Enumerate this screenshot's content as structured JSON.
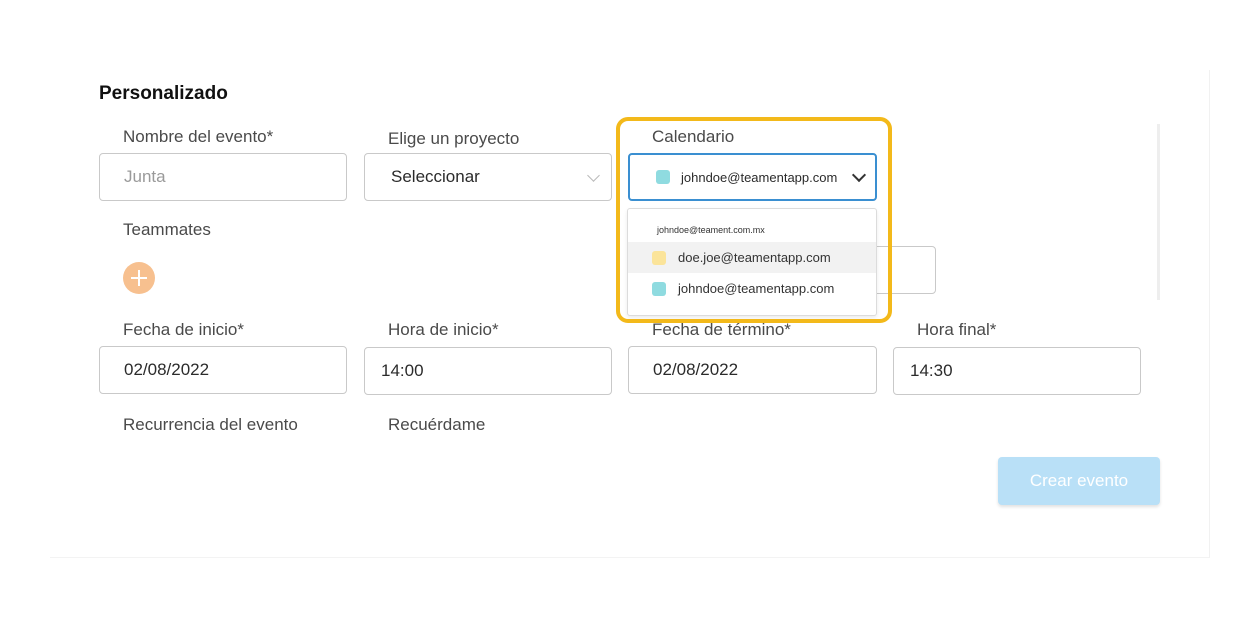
{
  "section_title": "Personalizado",
  "fields": {
    "event_name": {
      "label": "Nombre del evento*",
      "placeholder": "Junta"
    },
    "project": {
      "label": "Elige un proyecto",
      "value": "Seleccionar"
    },
    "calendar": {
      "label": "Calendario",
      "value": "johndoe@teamentapp.com",
      "swatch_color": "#8fdbe0"
    },
    "teammates": {
      "label": "Teammates"
    },
    "start_date": {
      "label": "Fecha de inicio*",
      "value": "02/08/2022"
    },
    "start_time": {
      "label": "Hora de inicio*",
      "value": "14:00"
    },
    "end_date": {
      "label": "Fecha de término*",
      "value": "02/08/2022"
    },
    "end_time": {
      "label": "Hora final*",
      "value": "14:30"
    },
    "recurrence": {
      "label": "Recurrencia del evento"
    },
    "reminder": {
      "label": "Recuérdame"
    }
  },
  "calendar_dropdown": {
    "group_header": "johndoe@teament.com.mx",
    "options": [
      {
        "label": "doe.joe@teamentapp.com",
        "swatch_color": "#fbe49a",
        "highlighted": true
      },
      {
        "label": "johndoe@teamentapp.com",
        "swatch_color": "#8fdbe0",
        "highlighted": false
      }
    ]
  },
  "create_button": {
    "label": "Crear evento"
  },
  "colors": {
    "highlight_border": "#f3b91a",
    "focus_border": "#3a8fd1",
    "add_button": "#f7c08f",
    "create_button_bg": "#b9e0f7"
  },
  "icons": {
    "add": "plus-circle-icon",
    "select_arrow": "chevron-down-icon"
  }
}
